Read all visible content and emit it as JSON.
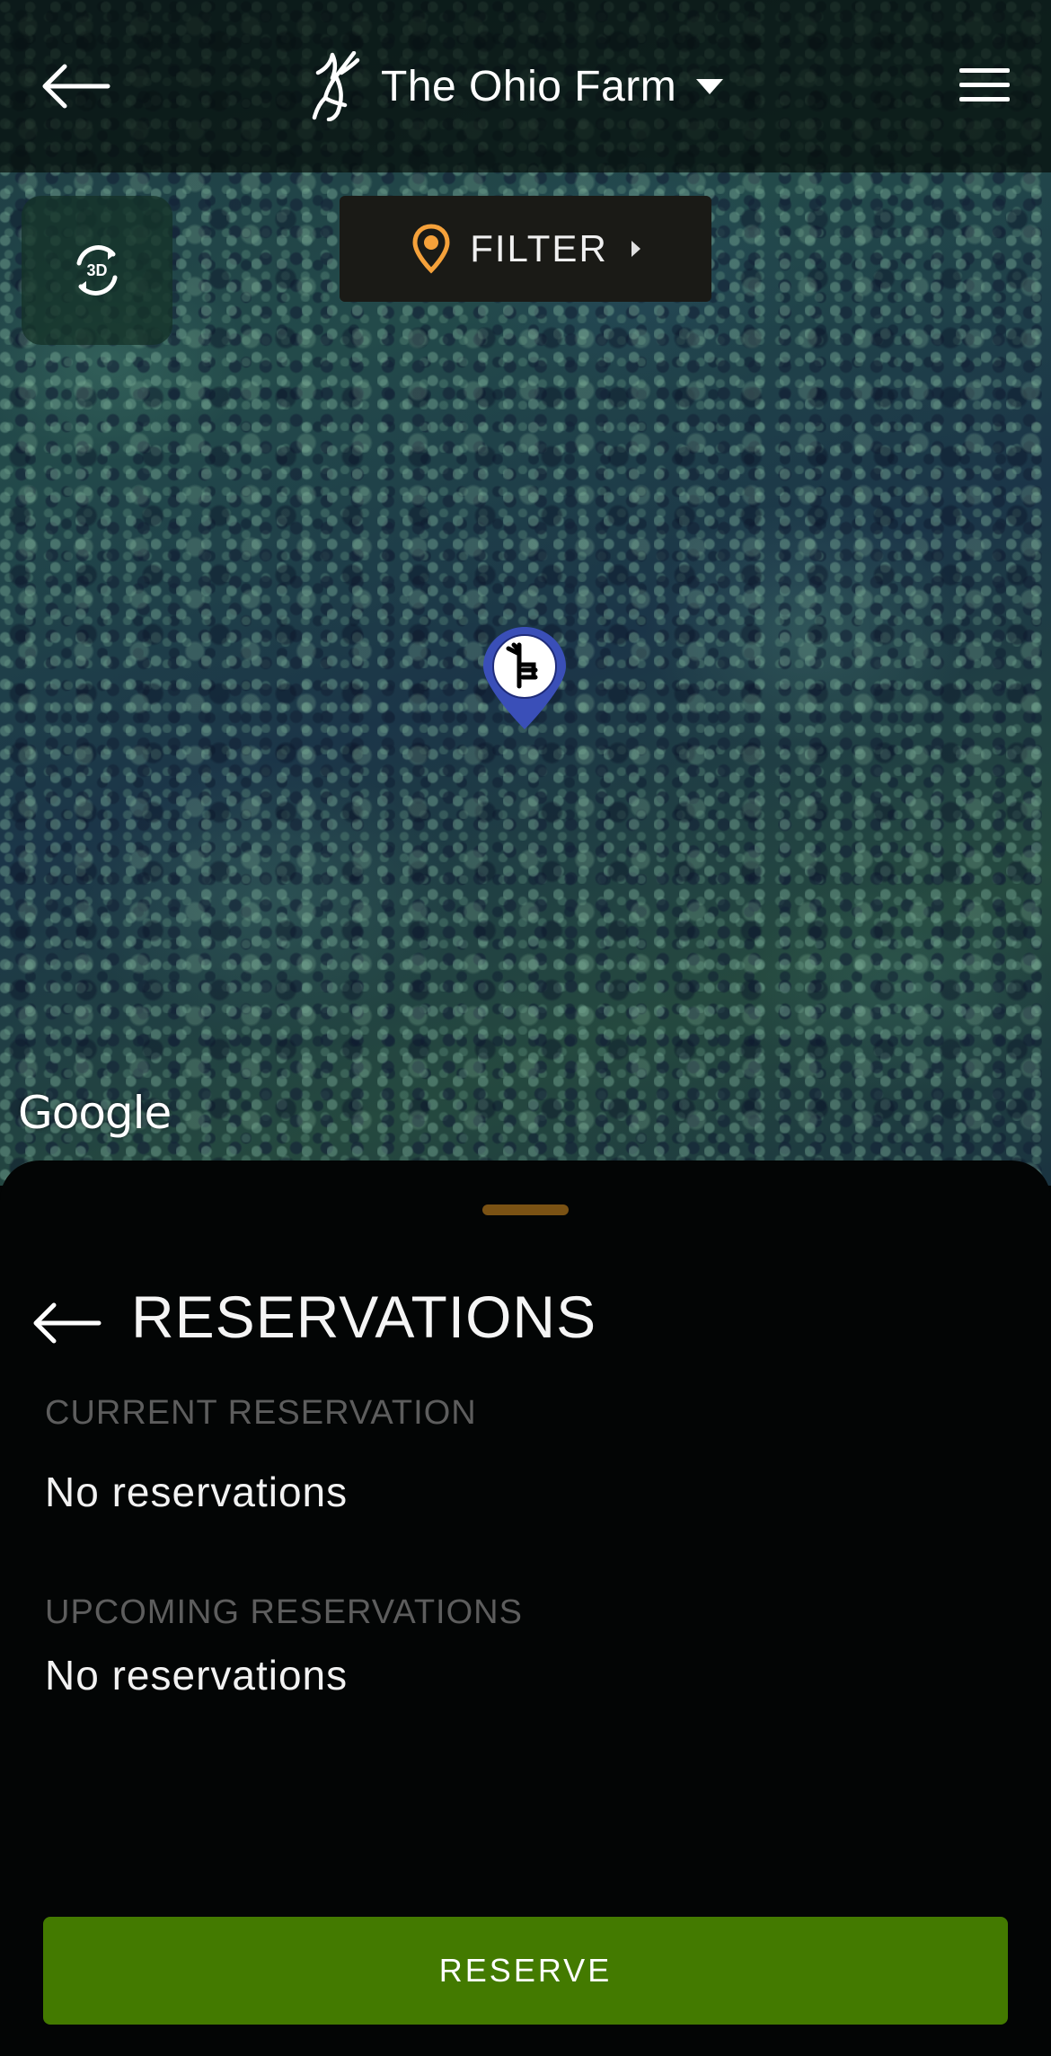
{
  "header": {
    "farm_name": "The Ohio Farm"
  },
  "map": {
    "view_mode_label": "3D",
    "filter_label": "FILTER",
    "attribution": "Google"
  },
  "reservations": {
    "title": "RESERVATIONS",
    "current_label": "CURRENT RESERVATION",
    "current_value": "No reservations",
    "upcoming_label": "UPCOMING RESERVATIONS",
    "upcoming_value": "No reservations",
    "reserve_button": "RESERVE"
  },
  "colors": {
    "accent_orange": "#f5a13a",
    "reserve_green": "#437a00",
    "pin_blue": "#3a4fb8",
    "handle_brown": "#7a5214"
  },
  "icons": {
    "back": "back-arrow-icon",
    "logo": "deer-antler-logo",
    "dropdown": "caret-down-icon",
    "menu": "hamburger-menu-icon",
    "rotate3d": "rotate-3d-icon",
    "location": "location-pin-icon",
    "filter_expand": "caret-right-icon",
    "map_marker": "tree-stand-pin-icon"
  }
}
